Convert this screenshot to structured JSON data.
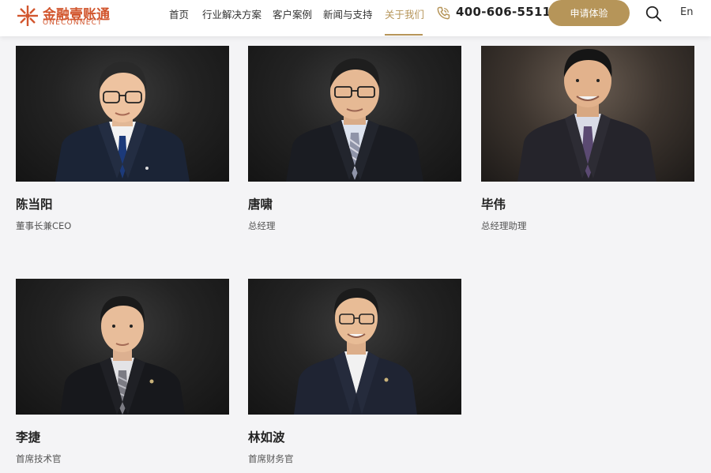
{
  "header": {
    "logo_cn": "金融壹账通",
    "logo_en": "ONECONNECT",
    "nav": [
      {
        "label": "首页"
      },
      {
        "label": "行业解决方案"
      },
      {
        "label": "客户案例"
      },
      {
        "label": "新闻与支持"
      },
      {
        "label": "关于我们",
        "active": true
      }
    ],
    "phone": "400-606-5511",
    "cta_label": "申请体验",
    "lang_label": "En"
  },
  "colors": {
    "accent": "#b69559",
    "brand": "#d2562e",
    "photo_bg": "#1c1c1c",
    "page_bg": "#f4f4f6"
  },
  "icons": {
    "logo": "oneconnect-logo-icon",
    "phone": "phone-icon",
    "search": "search-icon"
  },
  "executives": [
    {
      "name": "陈当阳",
      "title": "董事长兼CEO"
    },
    {
      "name": "唐啸",
      "title": "总经理"
    },
    {
      "name": "毕伟",
      "title": "总经理助理"
    },
    {
      "name": "李捷",
      "title": "首席技术官"
    },
    {
      "name": "林如波",
      "title": "首席财务官"
    }
  ]
}
